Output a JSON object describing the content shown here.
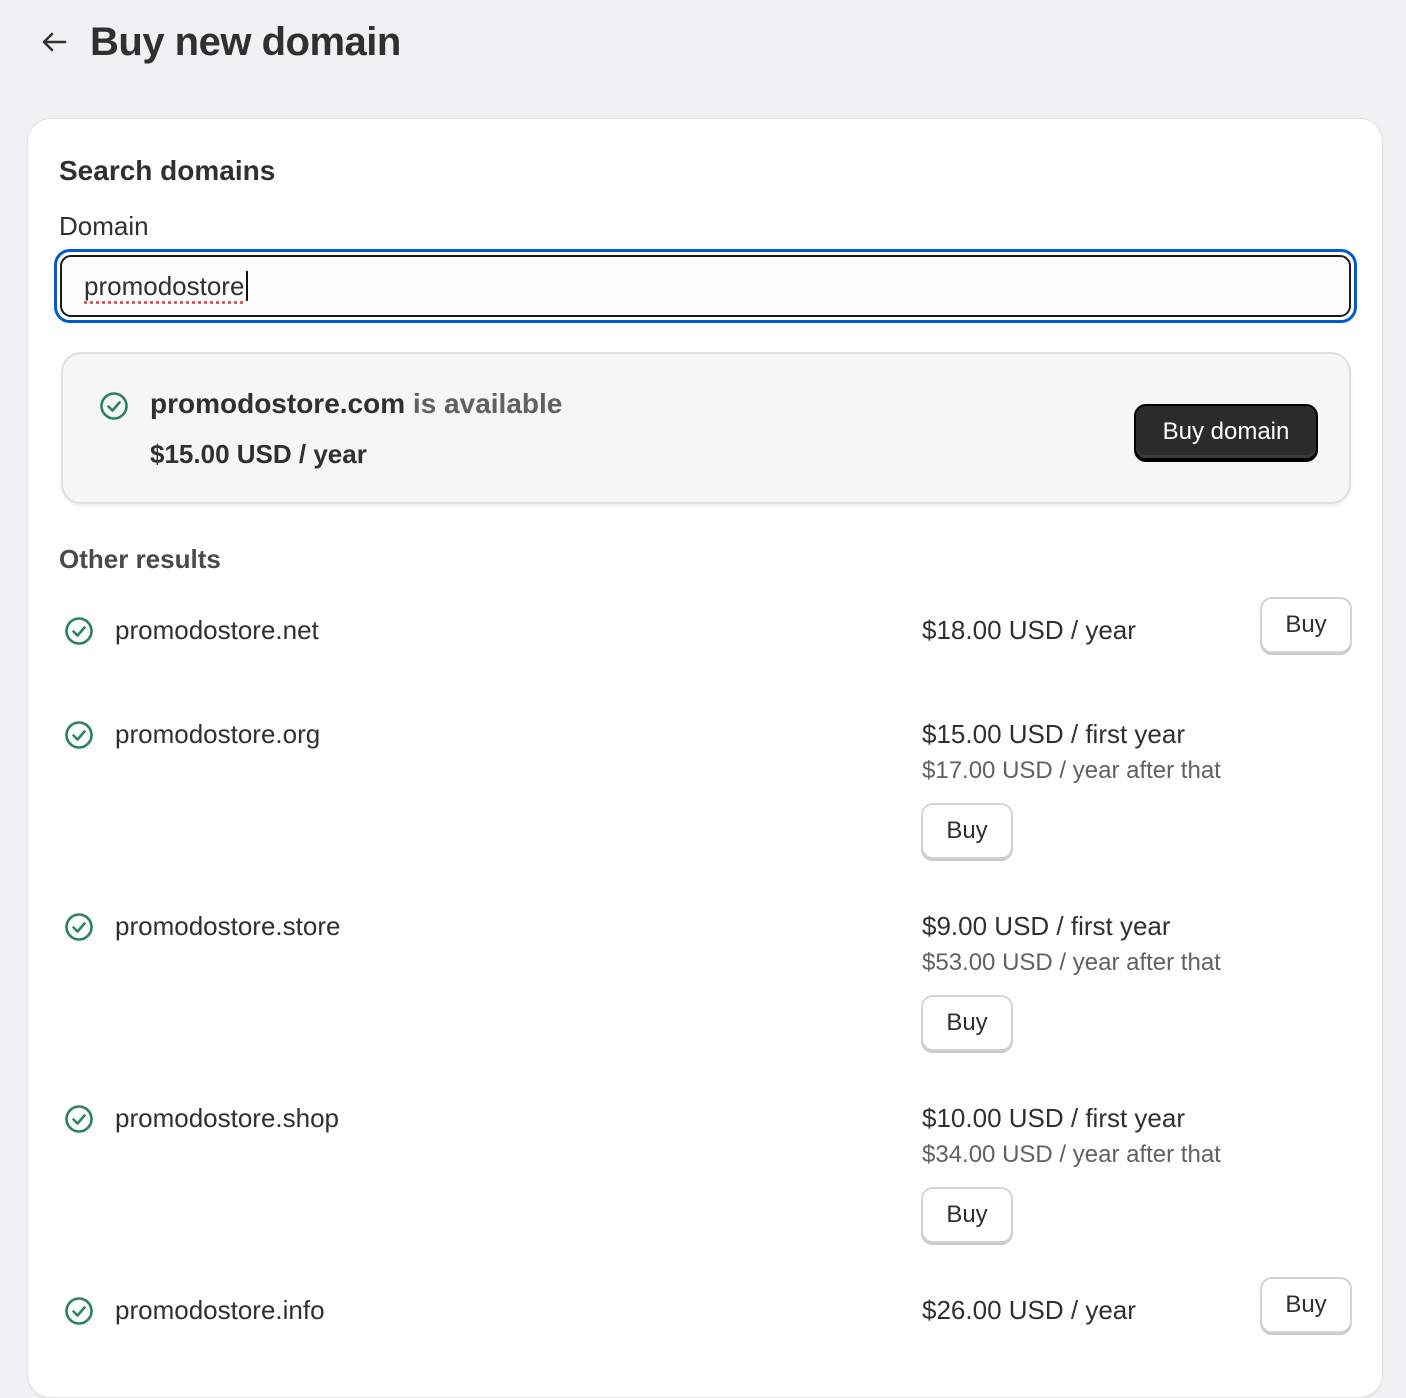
{
  "header": {
    "title": "Buy new domain",
    "back_icon": "arrow-left-icon"
  },
  "search": {
    "section_title": "Search domains",
    "field_label": "Domain",
    "value": "promodostore"
  },
  "featured": {
    "domain": "promodostore.com",
    "status": " is available",
    "price": "$15.00 USD / year",
    "button_label": "Buy domain"
  },
  "other_results": {
    "title": "Other results",
    "items": [
      {
        "domain": "promodostore.net",
        "price": "$18.00 USD / year",
        "price_after": "",
        "button_label": "Buy"
      },
      {
        "domain": "promodostore.org",
        "price": "$15.00 USD / first year",
        "price_after": "$17.00 USD / year after that",
        "button_label": "Buy"
      },
      {
        "domain": "promodostore.store",
        "price": "$9.00 USD / first year",
        "price_after": "$53.00 USD / year after that",
        "button_label": "Buy"
      },
      {
        "domain": "promodostore.shop",
        "price": "$10.00 USD / first year",
        "price_after": "$34.00 USD / year after that",
        "button_label": "Buy"
      },
      {
        "domain": "promodostore.info",
        "price": "$26.00 USD / year",
        "price_after": "",
        "button_label": "Buy"
      }
    ]
  },
  "colors": {
    "accent_focus": "#005bd3",
    "success_icon": "#29845a",
    "primary_button": "#2b2b2b"
  }
}
